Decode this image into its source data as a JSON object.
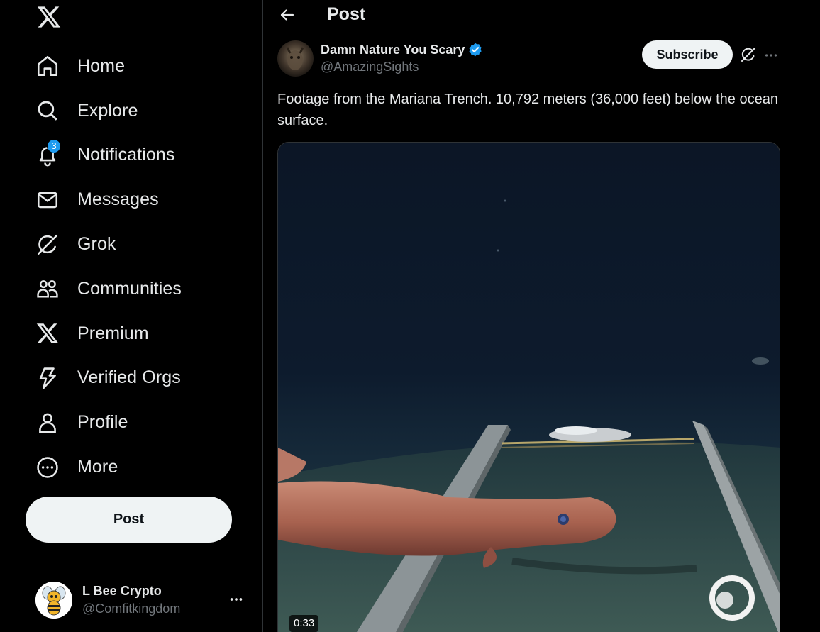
{
  "sidebar": {
    "logo_icon": "x-logo-icon",
    "nav": [
      {
        "label": "Home",
        "icon": "home-icon"
      },
      {
        "label": "Explore",
        "icon": "search-icon"
      },
      {
        "label": "Notifications",
        "icon": "bell-icon",
        "badge": "3"
      },
      {
        "label": "Messages",
        "icon": "envelope-icon"
      },
      {
        "label": "Grok",
        "icon": "grok-icon"
      },
      {
        "label": "Communities",
        "icon": "people-icon"
      },
      {
        "label": "Premium",
        "icon": "x-logo-icon"
      },
      {
        "label": "Verified Orgs",
        "icon": "lightning-icon"
      },
      {
        "label": "Profile",
        "icon": "person-icon"
      },
      {
        "label": "More",
        "icon": "more-circle-icon"
      }
    ],
    "post_button": "Post",
    "account": {
      "name": "L Bee Crypto",
      "handle": "@Comfitkingdom"
    }
  },
  "main": {
    "header_title": "Post",
    "tweet": {
      "author_name": "Damn Nature You Scary",
      "author_handle": "@AmazingSights",
      "subscribe_label": "Subscribe",
      "text": "Footage from the Mariana Trench. 10,792 meters (36,000 feet) below the ocean surface.",
      "video_duration": "0:33"
    }
  },
  "colors": {
    "background": "#000000",
    "text": "#e7e9ea",
    "muted": "#71767b",
    "accent": "#1d9bf0",
    "border": "#2f3336",
    "button_bg": "#eff3f4"
  }
}
